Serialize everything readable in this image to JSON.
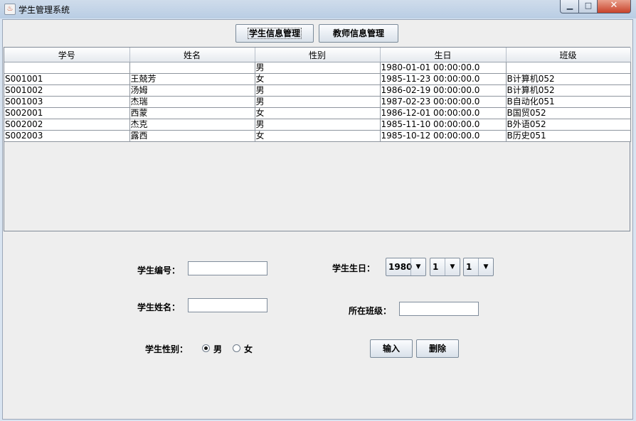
{
  "window": {
    "title": "学生管理系统",
    "icon": "java-cup-icon"
  },
  "tabs": [
    {
      "label": "学生信息管理"
    },
    {
      "label": "教师信息管理"
    }
  ],
  "table": {
    "columns": [
      "学号",
      "姓名",
      "性别",
      "生日",
      "班级"
    ],
    "rows": [
      [
        "",
        "",
        "男",
        "1980-01-01 00:00:00.0",
        ""
      ],
      [
        "S001001",
        "王兢芳",
        "女",
        "1985-11-23 00:00:00.0",
        "B计算机052"
      ],
      [
        "S001002",
        "汤姆",
        "男",
        "1986-02-19 00:00:00.0",
        "B计算机052"
      ],
      [
        "S001003",
        "杰瑞",
        "男",
        "1987-02-23 00:00:00.0",
        "B自动化051"
      ],
      [
        "S002001",
        "西蒙",
        "女",
        "1986-12-01 00:00:00.0",
        "B国贸052"
      ],
      [
        "S002002",
        "杰克",
        "男",
        "1985-11-10 00:00:00.0",
        "B外语052"
      ],
      [
        "S002003",
        "露西",
        "女",
        "1985-10-12 00:00:00.0",
        "B历史051"
      ]
    ]
  },
  "form": {
    "id_label": "学生编号：",
    "id_value": "",
    "name_label": "学生姓名：",
    "name_value": "",
    "gender_label": "学生性别：",
    "gender_male": "男",
    "gender_female": "女",
    "gender_selected": "男",
    "birthday_label": "学生生日：",
    "birthday_year": "1980",
    "birthday_month": "1",
    "birthday_day": "1",
    "class_label": "所在班级：",
    "class_value": "",
    "input_button": "输入",
    "delete_button": "删除"
  },
  "icons": {
    "dropdown": "chevron-down-icon"
  }
}
